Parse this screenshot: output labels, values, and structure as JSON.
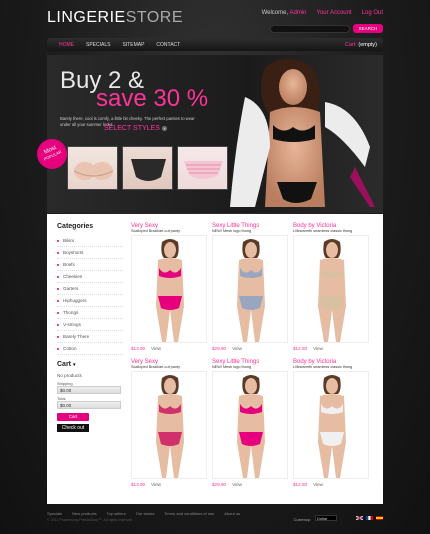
{
  "header": {
    "logo_part1": "LINGERIE",
    "logo_part2": "STORE",
    "welcome": "Welcome,",
    "user": "Admin",
    "your_account": "Your Account",
    "logout": "Log Out",
    "search_button": "SEARCH"
  },
  "nav": {
    "items": [
      "HOME",
      "SPECIALS",
      "SITEMAP",
      "CONTACT"
    ],
    "cart_label": "Cart:",
    "cart_value": "(empty)"
  },
  "banner": {
    "headline1": "Buy 2 &",
    "headline2": "save 30 %",
    "description": "Barely there, cool is comfy, a little bit cheeky. The perfect panties to wear under all your summer looks.",
    "cta": "SELECT STYLES",
    "badge1": "Most",
    "badge2": "POPULAR"
  },
  "sidebar": {
    "categories_title": "Categories",
    "categories": [
      "Bikini",
      "Boyshorts",
      "Briefs",
      "Cheekies",
      "Garters",
      "Hiphuggers",
      "Thongs",
      "V-strings",
      "Barely There",
      "Cotton"
    ],
    "cart_title": "Cart",
    "no_products": "No products",
    "shipping_label": "Shipping",
    "shipping_value": "$0.00",
    "total_label": "Total",
    "total_value": "$0.00",
    "cart_button": "Cart",
    "checkout_button": "Check out"
  },
  "products": [
    {
      "title": "Very Sexy",
      "desc": "Scalloped Brazilian-cut panty",
      "price": "$13.90",
      "view": "View",
      "color": "#e6007e"
    },
    {
      "title": "Sexy Little Things",
      "desc": "NEW! Mesh logo thong",
      "price": "$29.90",
      "view": "View",
      "color": "#9aa6c0"
    },
    {
      "title": "Body by Victoria",
      "desc": "Lillewarmth seamless classic thong",
      "price": "$12.50",
      "view": "View",
      "color": "#d8c0a0"
    },
    {
      "title": "Very Sexy",
      "desc": "Scalloped Brazilian-cut panty",
      "price": "$13.90",
      "view": "View",
      "color": "#d0306c"
    },
    {
      "title": "Sexy Little Things",
      "desc": "NEW! Mesh logo thong",
      "price": "$29.90",
      "view": "View",
      "color": "#e6007e"
    },
    {
      "title": "Body by Victoria",
      "desc": "Lillewarmth seamless classic thong",
      "price": "$12.50",
      "view": "View",
      "color": "#f0f0f0"
    }
  ],
  "footer": {
    "links": [
      "Specials",
      "New products",
      "Top sellers",
      "Our stores",
      "Terms and conditions of use",
      "About us"
    ],
    "copyright": "© 2011 Powered by PrestaShop™. All rights reserved",
    "currency_label": "Currency:",
    "currency_value": "Dollar"
  }
}
